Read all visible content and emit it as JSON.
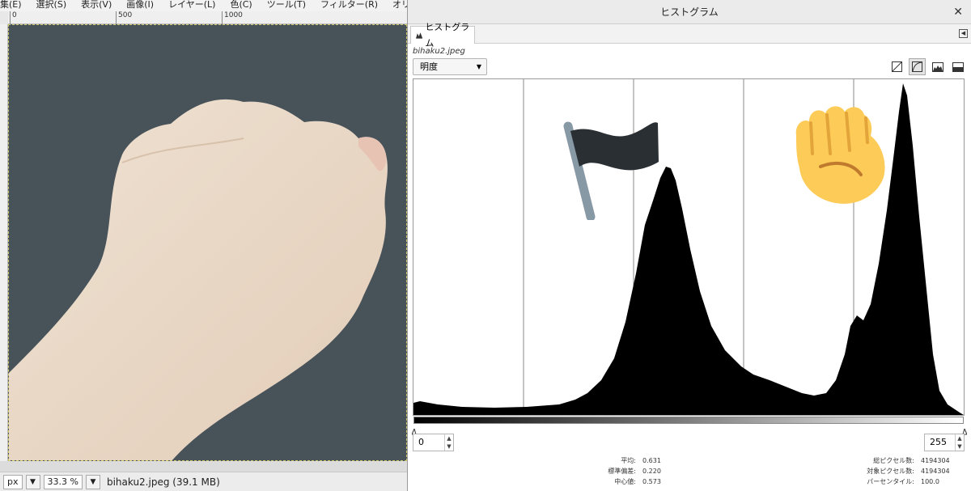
{
  "menubar": [
    "集(E)",
    "選択(S)",
    "表示(V)",
    "画像(I)",
    "レイヤー(L)",
    "色(C)",
    "ツール(T)",
    "フィルター(R)",
    "オリジナル"
  ],
  "ruler": {
    "ticks": [
      "0",
      "500",
      "1000"
    ]
  },
  "statusbar": {
    "unit": "px",
    "zoom": "33.3 %",
    "file_info": "bihaku2.jpeg (39.1 MB)"
  },
  "dialog": {
    "title": "ヒストグラム",
    "close_glyph": "✕",
    "tab_label": "ヒストグラム",
    "filename": "bihaku2.jpeg",
    "channel": "明度",
    "range_low": "0",
    "range_high": "255",
    "stats_left": [
      {
        "label": "平均:",
        "value": "0.631"
      },
      {
        "label": "標準偏差:",
        "value": "0.220"
      },
      {
        "label": "中心値:",
        "value": "0.573"
      }
    ],
    "stats_right": [
      {
        "label": "総ピクセル数:",
        "value": "4194304"
      },
      {
        "label": "対象ピクセル数:",
        "value": "4194304"
      },
      {
        "label": "パーセンタイル:",
        "value": "100.0"
      }
    ]
  },
  "overlays": {
    "flag": "black-flag-emoji",
    "fist": "raised-fist-emoji"
  },
  "colors": {
    "flag": "#292f33",
    "flagpole": "#8899a6",
    "fist": "#fdcb58",
    "canvas_bg": "#485259",
    "skin": "#e8d6c5"
  }
}
